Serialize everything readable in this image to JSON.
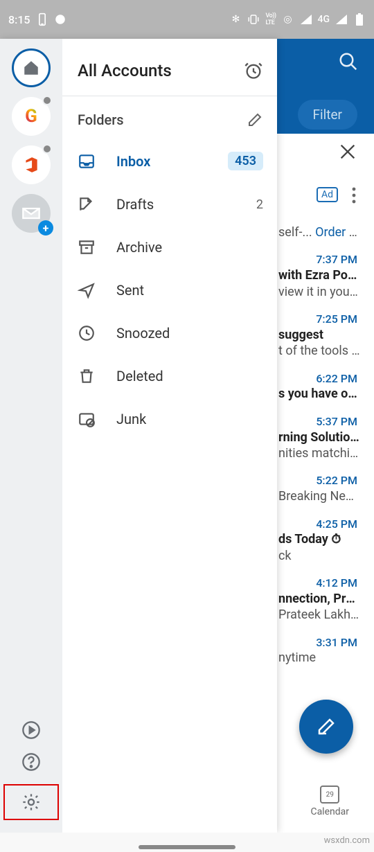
{
  "status": {
    "time": "8:15",
    "net_label": "4G"
  },
  "background": {
    "filter": "Filter",
    "ad": "Ad",
    "compose": "compose",
    "calendar_label": "Calendar",
    "calendar_day": "29",
    "footer": "wsxdn.com",
    "rows": [
      {
        "time": "",
        "sub": "self-...",
        "link": "Order now",
        "prev": ""
      },
      {
        "time": "7:37 PM",
        "sub": "with Ezra Pound",
        "prev": "view it in your br..."
      },
      {
        "time": "7:25 PM",
        "sub": "suggest",
        "prev": "t of the tools ou..."
      },
      {
        "time": "6:22 PM",
        "sub": "s you have on T...",
        "prev": ""
      },
      {
        "time": "5:37 PM",
        "sub": "rning Solutions ...",
        "prev": "nities matching ..."
      },
      {
        "time": "5:22 PM",
        "sub": "",
        "prev": "Breaking News e..."
      },
      {
        "time": "4:25 PM",
        "sub": "ds Today ⏱",
        "prev": "ck"
      },
      {
        "time": "4:12 PM",
        "sub": "nnection, Preeti",
        "prev": "Prateek Lakher..."
      },
      {
        "time": "3:31 PM",
        "sub": "",
        "prev": "nytime"
      }
    ]
  },
  "drawer": {
    "title": "All Accounts",
    "folders_label": "Folders",
    "folders": [
      {
        "key": "inbox",
        "label": "Inbox",
        "count": "453",
        "badge": true,
        "selected": true
      },
      {
        "key": "drafts",
        "label": "Drafts",
        "count": "2",
        "badge": false,
        "selected": false
      },
      {
        "key": "archive",
        "label": "Archive",
        "count": "",
        "badge": false,
        "selected": false
      },
      {
        "key": "sent",
        "label": "Sent",
        "count": "",
        "badge": false,
        "selected": false
      },
      {
        "key": "snoozed",
        "label": "Snoozed",
        "count": "",
        "badge": false,
        "selected": false
      },
      {
        "key": "deleted",
        "label": "Deleted",
        "count": "",
        "badge": false,
        "selected": false
      },
      {
        "key": "junk",
        "label": "Junk",
        "count": "",
        "badge": false,
        "selected": false
      }
    ]
  }
}
